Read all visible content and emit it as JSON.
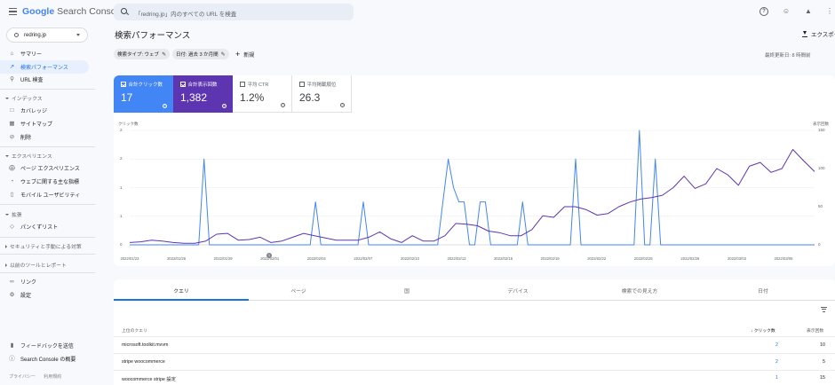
{
  "header": {
    "logo_google": "Google",
    "logo_product": "Search Console",
    "search_placeholder": "「redring.jp」内のすべての URL を検査"
  },
  "property": "redring.jp",
  "sidebar": {
    "items_top": [
      {
        "label": "サマリー",
        "icon": "home-icon"
      },
      {
        "label": "検索パフォーマンス",
        "icon": "trending-icon",
        "active": true
      },
      {
        "label": "URL 検査",
        "icon": "search-icon"
      }
    ],
    "section_index": "インデックス",
    "items_index": [
      {
        "label": "カバレッジ",
        "icon": "coverage-icon"
      },
      {
        "label": "サイトマップ",
        "icon": "sitemap-icon"
      },
      {
        "label": "削除",
        "icon": "removal-icon"
      }
    ],
    "section_experience": "エクスペリエンス",
    "items_experience": [
      {
        "label": "ページ エクスペリエンス",
        "icon": "experience-icon"
      },
      {
        "label": "ウェブに関する主な指標",
        "icon": "speed-icon"
      },
      {
        "label": "モバイル ユーザビリティ",
        "icon": "mobile-icon"
      }
    ],
    "section_enhance": "拡張",
    "items_enhance": [
      {
        "label": "パンくずリスト",
        "icon": "breadcrumb-icon"
      }
    ],
    "section_security": "セキュリティと手動による対策",
    "section_legacy": "以前のツールとレポート",
    "items_bottom": [
      {
        "label": "リンク",
        "icon": "links-icon"
      },
      {
        "label": "設定",
        "icon": "settings-icon"
      }
    ],
    "items_footer": [
      {
        "label": "フィードバックを送信",
        "icon": "feedback-icon"
      },
      {
        "label": "Search Console の概要",
        "icon": "info-icon"
      }
    ],
    "footer_links": [
      "プライバシー",
      "利用規約"
    ]
  },
  "main": {
    "title": "検索パフォーマンス",
    "export_label": "エクスポー",
    "chips": [
      "検索タイプ: ウェブ",
      "日付: 過去 3 か月間"
    ],
    "new_label": "新規",
    "updated_text": "最終更新日: 8 時間前"
  },
  "metrics": [
    {
      "label": "合計クリック数",
      "value": "17"
    },
    {
      "label": "合計表示回数",
      "value": "1,382"
    },
    {
      "label": "平均 CTR",
      "value": "1.2%"
    },
    {
      "label": "平均掲載順位",
      "value": "26.3"
    }
  ],
  "colors": {
    "clicks": "#4285f4",
    "impressions": "#5e35b1"
  },
  "chart_data": {
    "type": "line",
    "ylabel_left": "クリック数",
    "ylabel_right": "表示回数",
    "yticks_left": [
      "2",
      "2",
      "1",
      "1",
      "0"
    ],
    "yticks_right": [
      "150",
      "100",
      "50",
      "0"
    ],
    "ylim_left": [
      0,
      2
    ],
    "ylim_right": [
      0,
      150
    ],
    "xticks": [
      "2022/01/23",
      "2022/01/26",
      "2022/01/29",
      "2022/02/01",
      "2022/02/04",
      "2022/02/07",
      "2022/02/10",
      "2022/02/13",
      "2022/02/16",
      "2022/02/19",
      "2022/02/22",
      "2022/02/25",
      "2022/02/28",
      "2022/03/03",
      "2022/03/06"
    ],
    "series": [
      {
        "name": "合計クリック数",
        "axis": "left",
        "values": [
          0,
          0,
          0,
          0,
          0,
          0,
          0,
          0,
          0,
          0,
          0,
          0,
          0,
          0,
          1.5,
          0,
          0,
          0,
          0,
          0,
          0,
          0,
          0,
          0,
          0,
          0,
          0,
          0,
          0,
          0,
          0,
          0,
          0,
          0,
          0,
          0.75,
          0,
          0,
          0,
          0,
          0,
          0,
          0,
          0,
          0.75,
          0,
          0,
          0,
          0,
          0,
          0,
          0,
          0,
          0,
          0,
          0,
          0,
          0,
          0,
          0.75,
          1.5,
          1,
          0.75,
          0.75,
          0,
          0,
          0.75,
          0.75,
          0,
          0,
          0,
          0,
          0,
          0,
          0.75,
          0,
          0,
          0,
          0,
          0,
          0,
          0,
          0,
          0,
          1.5,
          0,
          0,
          0,
          0,
          0,
          0,
          0,
          0,
          0,
          0,
          0,
          2,
          0,
          0,
          1.5,
          0,
          0,
          0,
          0,
          0,
          0,
          0,
          0,
          0,
          0,
          0,
          0,
          0,
          0,
          0,
          0,
          0,
          0,
          0,
          0,
          0,
          0,
          0,
          0,
          0,
          0,
          0,
          0,
          0,
          0
        ]
      },
      {
        "name": "合計表示回数",
        "axis": "right",
        "values": [
          3,
          4,
          6,
          5,
          3,
          2,
          2,
          5,
          14,
          15,
          6,
          7,
          10,
          3,
          5,
          10,
          15,
          12,
          9,
          6,
          6,
          6,
          10,
          17,
          8,
          3,
          12,
          5,
          5,
          12,
          28,
          27,
          25,
          18,
          16,
          12,
          12,
          20,
          38,
          36,
          50,
          50,
          46,
          39,
          41,
          50,
          56,
          60,
          62,
          65,
          75,
          90,
          74,
          80,
          100,
          92,
          78,
          103,
          108,
          95,
          100,
          125,
          110,
          96
        ]
      }
    ]
  },
  "table": {
    "tabs": [
      "クエリ",
      "ページ",
      "国",
      "デバイス",
      "検索での見え方",
      "日付"
    ],
    "headers": {
      "query": "上位のクエリ",
      "clicks": "クリック数",
      "impressions": "表示回数"
    },
    "rows": [
      {
        "query": "microsoft.toolkit.mvvm",
        "clicks": "2",
        "impressions": "10"
      },
      {
        "query": "stripe woocommerce",
        "clicks": "2",
        "impressions": "5"
      },
      {
        "query": "woocommerce stripe 設定",
        "clicks": "1",
        "impressions": "15"
      }
    ]
  }
}
